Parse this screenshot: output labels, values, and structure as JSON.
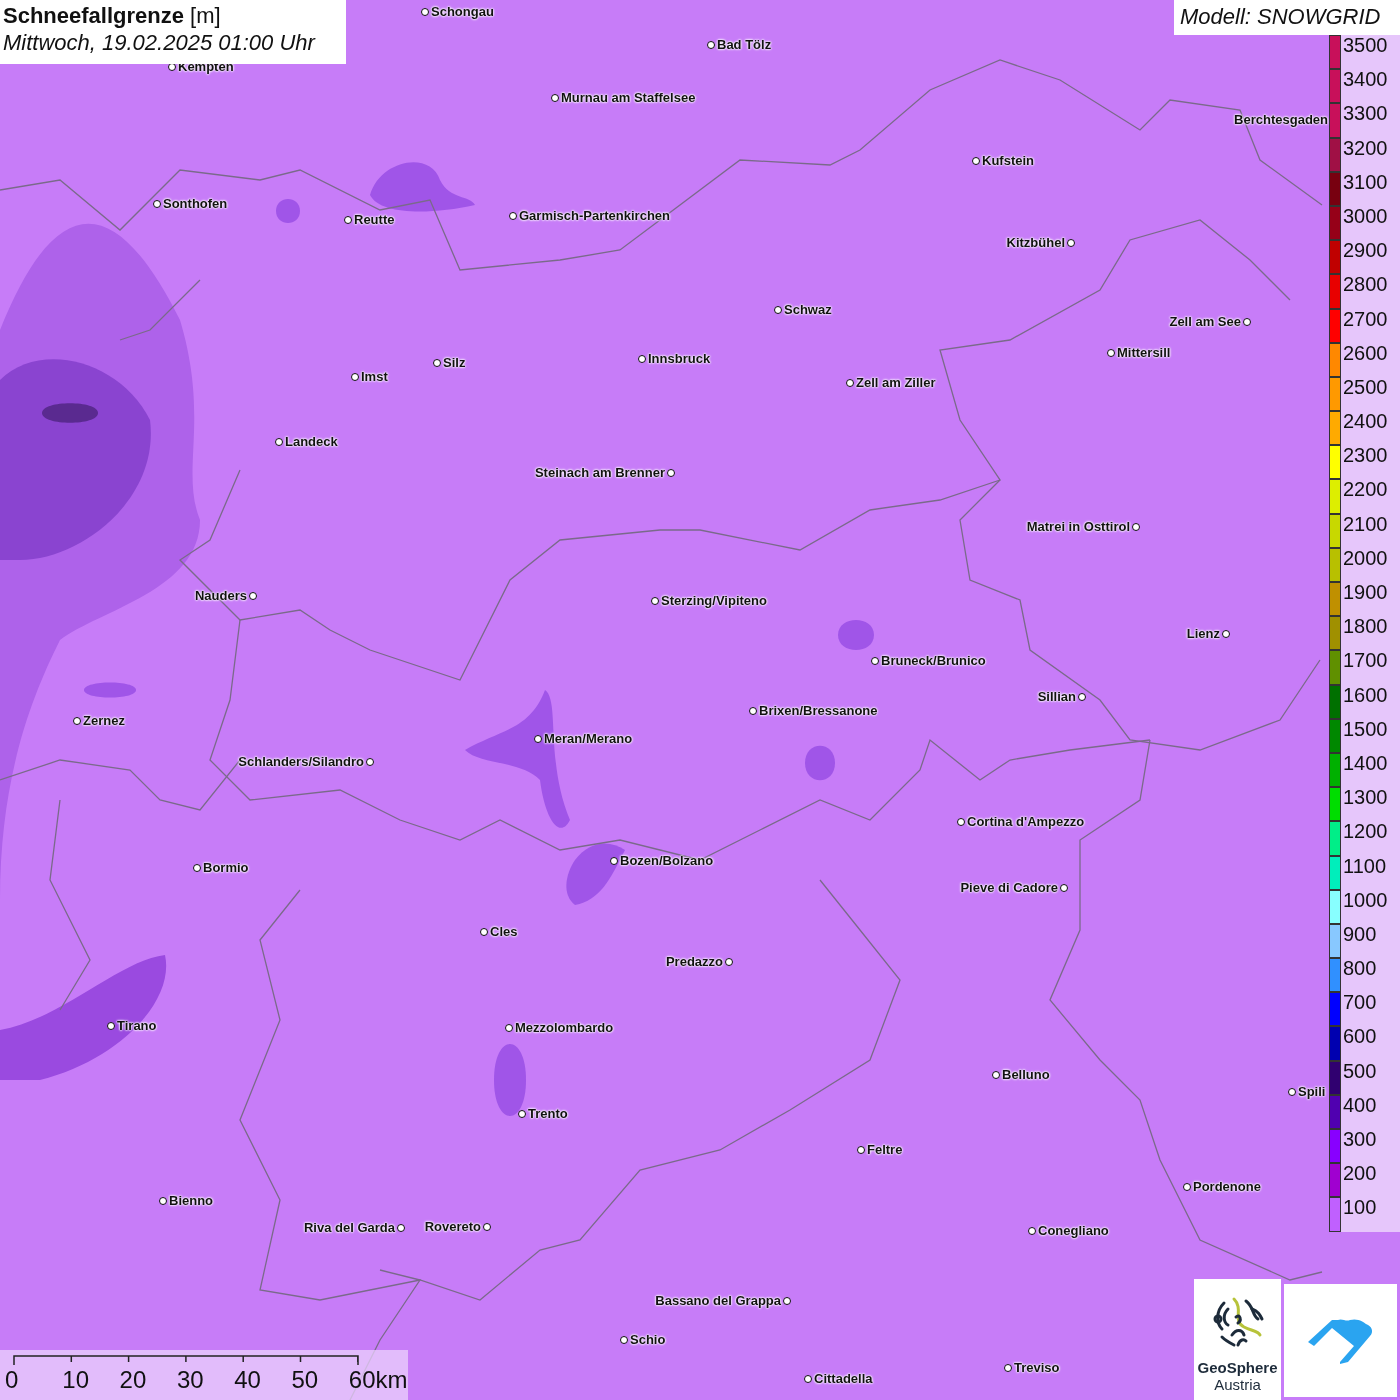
{
  "header": {
    "title": "**Schneefallgrenze** [m]",
    "datetime": "Mittwoch, 19.02.2025 01:00 Uhr"
  },
  "model_label": "Modell: SNOWGRID",
  "legend": [
    {
      "label": "3500",
      "color": "#c8105a"
    },
    {
      "label": "3400",
      "color": "#c8105a"
    },
    {
      "label": "3300",
      "color": "#c8105a"
    },
    {
      "label": "3200",
      "color": "#a01045"
    },
    {
      "label": "3100",
      "color": "#780010"
    },
    {
      "label": "3000",
      "color": "#960018"
    },
    {
      "label": "2900",
      "color": "#c00000"
    },
    {
      "label": "2800",
      "color": "#e80000"
    },
    {
      "label": "2700",
      "color": "#ff0000"
    },
    {
      "label": "2600",
      "color": "#ff8800"
    },
    {
      "label": "2500",
      "color": "#ff9900"
    },
    {
      "label": "2400",
      "color": "#ffaa00"
    },
    {
      "label": "2300",
      "color": "#ffff00"
    },
    {
      "label": "2200",
      "color": "#ddee00"
    },
    {
      "label": "2100",
      "color": "#c8d800"
    },
    {
      "label": "2000",
      "color": "#b8c000"
    },
    {
      "label": "1900",
      "color": "#c09000"
    },
    {
      "label": "1800",
      "color": "#a09000"
    },
    {
      "label": "1700",
      "color": "#609000"
    },
    {
      "label": "1600",
      "color": "#007000"
    },
    {
      "label": "1500",
      "color": "#008800"
    },
    {
      "label": "1400",
      "color": "#00b000"
    },
    {
      "label": "1300",
      "color": "#00dd00"
    },
    {
      "label": "1200",
      "color": "#00ee88"
    },
    {
      "label": "1100",
      "color": "#00eebb"
    },
    {
      "label": "1000",
      "color": "#88ffff"
    },
    {
      "label": "900",
      "color": "#88c8ff"
    },
    {
      "label": "800",
      "color": "#3090ff"
    },
    {
      "label": "700",
      "color": "#0000ff"
    },
    {
      "label": "600",
      "color": "#0000b0"
    },
    {
      "label": "500",
      "color": "#300070"
    },
    {
      "label": "400",
      "color": "#5000b0"
    },
    {
      "label": "300",
      "color": "#8800ff"
    },
    {
      "label": "200",
      "color": "#a000d0"
    },
    {
      "label": "100",
      "color": "#c060ff"
    }
  ],
  "cities": [
    {
      "name": "Schongau"
    },
    {
      "name": "Bad Tölz"
    },
    {
      "name": "Kempten"
    },
    {
      "name": "Murnau am Staffelsee"
    },
    {
      "name": "Berchtesgaden"
    },
    {
      "name": "Kufstein"
    },
    {
      "name": "Sonthofen"
    },
    {
      "name": "Reutte"
    },
    {
      "name": "Garmisch-Partenkirchen"
    },
    {
      "name": "Kitzbühel"
    },
    {
      "name": "Schwaz"
    },
    {
      "name": "Zell am See"
    },
    {
      "name": "Innsbruck"
    },
    {
      "name": "Mittersill"
    },
    {
      "name": "Silz"
    },
    {
      "name": "Imst"
    },
    {
      "name": "Zell am Ziller"
    },
    {
      "name": "Landeck"
    },
    {
      "name": "Steinach am Brenner"
    },
    {
      "name": "Matrei in Osttirol"
    },
    {
      "name": "Nauders"
    },
    {
      "name": "Sterzing/Vipiteno"
    },
    {
      "name": "Lienz"
    },
    {
      "name": "Bruneck/Brunico"
    },
    {
      "name": "Sillian"
    },
    {
      "name": "Brixen/Bressanone"
    },
    {
      "name": "Zernez"
    },
    {
      "name": "Meran/Merano"
    },
    {
      "name": "Schlanders/Silandro"
    },
    {
      "name": "Cortina d'Ampezzo"
    },
    {
      "name": "Bozen/Bolzano"
    },
    {
      "name": "Bormio"
    },
    {
      "name": "Pieve di Cadore"
    },
    {
      "name": "Cles"
    },
    {
      "name": "Predazzo"
    },
    {
      "name": "Tirano"
    },
    {
      "name": "Mezzolombardo"
    },
    {
      "name": "Belluno"
    },
    {
      "name": "Spili"
    },
    {
      "name": "Trento"
    },
    {
      "name": "Feltre"
    },
    {
      "name": "Pordenone"
    },
    {
      "name": "Bienno"
    },
    {
      "name": "Riva del Garda"
    },
    {
      "name": "Rovereto"
    },
    {
      "name": "Conegliano"
    },
    {
      "name": "Bassano del Grappa"
    },
    {
      "name": "Schio"
    },
    {
      "name": "Treviso"
    },
    {
      "name": "Cittadella"
    }
  ],
  "scale_bar": {
    "ticks": [
      "0",
      "10",
      "20",
      "30",
      "40",
      "50",
      "60km"
    ]
  },
  "partner_logo": {
    "name": "GeoSphere",
    "subtitle": "Austria"
  }
}
